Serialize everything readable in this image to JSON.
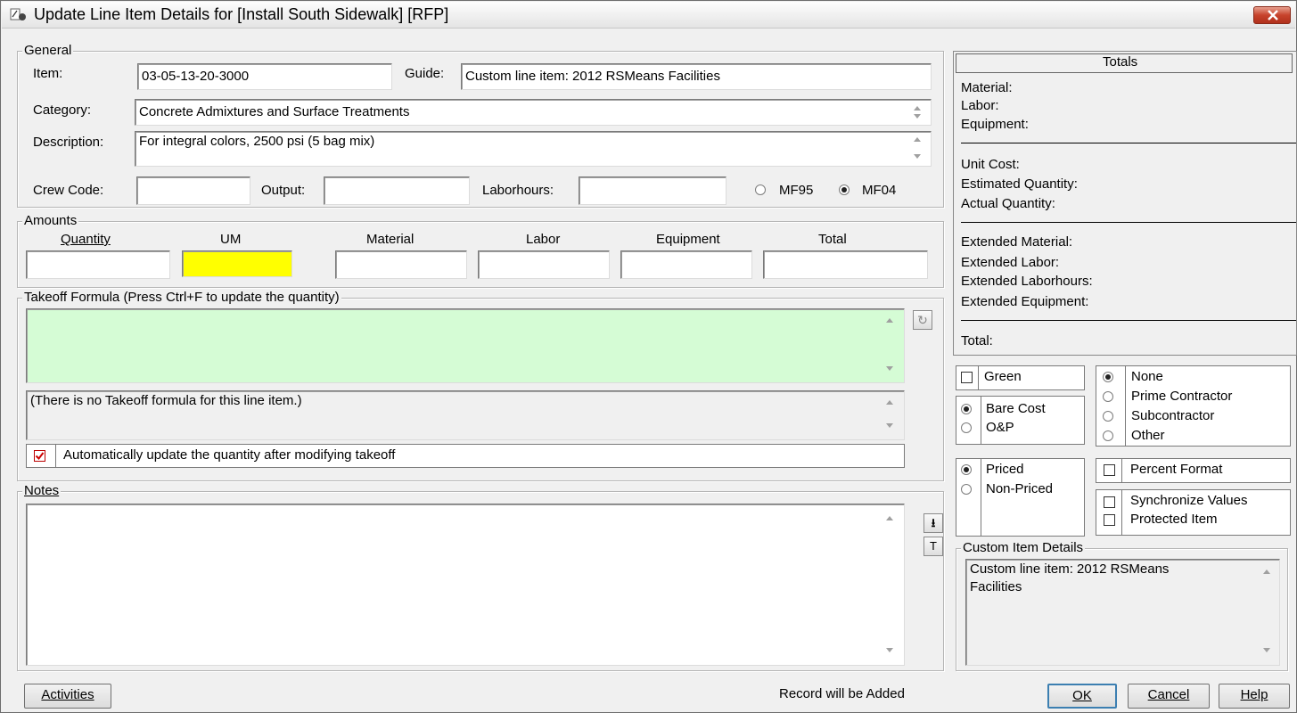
{
  "window": {
    "title": "Update Line Item Details for [Install South Sidewalk] [RFP]"
  },
  "general": {
    "group_label": "General",
    "item_label": "Item:",
    "item_value": "03-05-13-20-3000",
    "guide_label": "Guide:",
    "guide_value": "Custom line item: 2012 RSMeans Facilities",
    "category_label": "Category:",
    "category_value": "Concrete Admixtures and Surface Treatments",
    "description_label": "Description:",
    "description_value": "For integral colors, 2500 psi (5 bag mix)",
    "crew_code_label": "Crew Code:",
    "crew_code_value": "",
    "output_label": "Output:",
    "output_value": "",
    "laborhours_label": "Laborhours:",
    "laborhours_value": "",
    "mf95_label": "MF95",
    "mf04_label": "MF04",
    "selected_mf": "MF04"
  },
  "amounts": {
    "group_label": "Amounts",
    "headers": [
      "Quantity",
      "UM",
      "Material",
      "Labor",
      "Equipment",
      "Total"
    ],
    "values": [
      "",
      "",
      "",
      "",
      "",
      ""
    ],
    "um_highlight_color": "#ffff00"
  },
  "takeoff": {
    "group_label": "Takeoff Formula (Press Ctrl+F to update the quantity)",
    "formula_value": "",
    "formula_bg_color": "#d5fcd5",
    "message": "(There is no Takeoff formula for this line item.)",
    "auto_update_label": "Automatically update the quantity after modifying takeoff",
    "auto_update_checked": true
  },
  "notes": {
    "group_label": "Notes",
    "value": ""
  },
  "totals": {
    "header": "Totals",
    "rows1": [
      "Material:",
      "Labor:",
      "Equipment:"
    ],
    "rows2": [
      "Unit Cost:",
      "Estimated Quantity:",
      "Actual Quantity:"
    ],
    "rows3": [
      "Extended Material:",
      "Extended Labor:",
      "Extended Laborhours:",
      "Extended Equipment:"
    ],
    "total_label": "Total:"
  },
  "options": {
    "green_label": "Green",
    "green_checked": false,
    "contractor_options": [
      "None",
      "Prime Contractor",
      "Subcontractor",
      "Other"
    ],
    "contractor_selected": "None",
    "cost_options": [
      "Bare Cost",
      "O&P"
    ],
    "cost_selected": "Bare Cost",
    "pricing_options": [
      "Priced",
      "Non-Priced"
    ],
    "pricing_selected": "Priced",
    "percent_format_label": "Percent Format",
    "synchronize_label": "Synchronize Values",
    "protected_label": "Protected Item"
  },
  "custom_item": {
    "group_label": "Custom Item Details",
    "text_line1": "Custom line item: 2012 RSMeans",
    "text_line2": "Facilities"
  },
  "footer": {
    "activities_label": "Activities",
    "status": "Record will be Added",
    "ok_label": "OK",
    "cancel_label": "Cancel",
    "help_label": "Help"
  }
}
